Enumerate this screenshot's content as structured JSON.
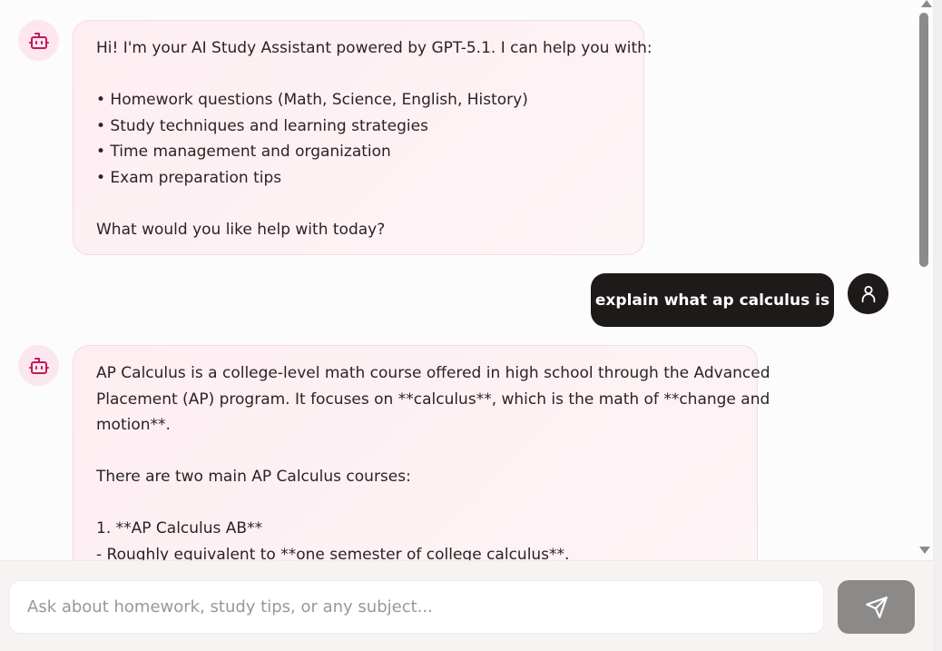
{
  "messages": [
    {
      "role": "assistant",
      "icon": "robot-icon",
      "lines": [
        "Hi! I'm your AI Study Assistant powered by GPT-5.1. I can help you with:",
        "",
        "• Homework questions (Math, Science, English, History)",
        "• Study techniques and learning strategies",
        "• Time management and organization",
        "• Exam preparation tips",
        "",
        "What would you like help with today?"
      ]
    },
    {
      "role": "user",
      "icon": "user-icon",
      "text": "explain what ap calculus is"
    },
    {
      "role": "assistant",
      "icon": "robot-icon",
      "lines": [
        "AP Calculus is a college-level math course offered in high school through the Advanced",
        "Placement (AP) program. It focuses on **calculus**, which is the math of **change and",
        "motion**.",
        "",
        "There are two main AP Calculus courses:",
        "",
        "1. **AP Calculus AB**",
        "- Roughly equivalent to **one semester of college calculus**."
      ]
    }
  ],
  "composer": {
    "placeholder": "Ask about homework, study tips, or any subject...",
    "value": "",
    "send_icon": "send-icon"
  },
  "colors": {
    "accent": "#c2185b",
    "bot_bubble": "#fdeef2",
    "user_bubble": "#1e1a19",
    "send_button": "#8c8a89"
  }
}
